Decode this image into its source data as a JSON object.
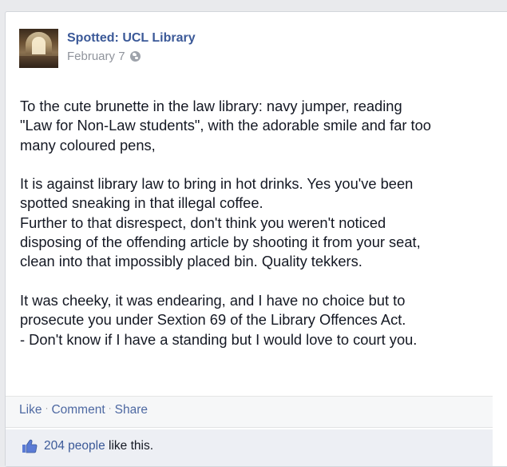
{
  "post": {
    "page_name": "Spotted: UCL Library",
    "date": "February 7",
    "privacy_icon": "globe-icon",
    "body_paragraphs": [
      {
        "lines": [
          "To the cute brunette in the law library: navy jumper, reading",
          "\"Law for Non-Law students\", with the adorable smile and far too",
          "many coloured pens,"
        ]
      },
      {
        "lines": [
          "It is against library law to bring in hot drinks. Yes you've been",
          "spotted sneaking in that illegal coffee.",
          "Further to that disrespect, don't think you weren't noticed",
          "disposing of the offending article by shooting it from your seat,",
          "clean into that impossibly placed bin. Quality tekkers."
        ]
      },
      {
        "lines": [
          "It was cheeky, it was endearing, and I have no choice but to",
          "prosecute you under Sextion 69 of the Library Offences Act.",
          "- Don't know if I have a standing but I would love to court you."
        ]
      }
    ]
  },
  "actions": {
    "like": "Like",
    "comment": "Comment",
    "share": "Share",
    "separator": "·"
  },
  "likes": {
    "count_text": "204 people",
    "suffix": "like this.",
    "icon": "thumbs-up-icon"
  },
  "colors": {
    "link": "#3b5998",
    "text": "#141823",
    "meta": "#90949c"
  }
}
